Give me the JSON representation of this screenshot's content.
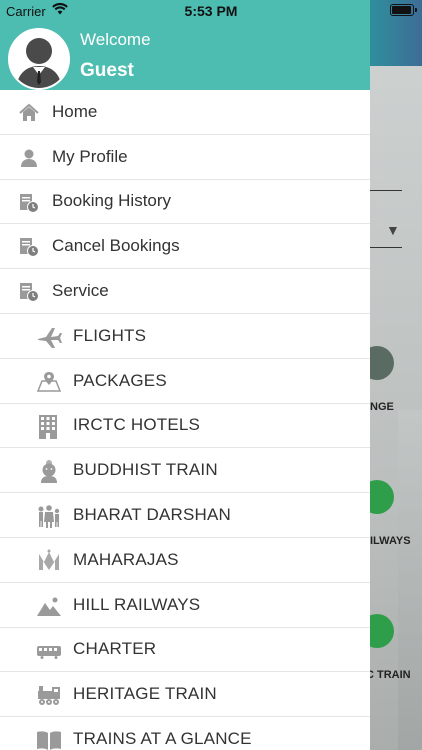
{
  "status_bar": {
    "carrier": "Carrier",
    "time": "5:53 PM"
  },
  "drawer": {
    "header_color": "#4dbdb1",
    "welcome": "Welcome",
    "user_name": "Guest",
    "menu_items": [
      {
        "label": "Home",
        "icon": "home-icon"
      },
      {
        "label": "My Profile",
        "icon": "profile-icon"
      },
      {
        "label": "Booking History",
        "icon": "booking-history-icon"
      },
      {
        "label": "Cancel Bookings",
        "icon": "cancel-bookings-icon"
      },
      {
        "label": "Service",
        "icon": "service-icon"
      }
    ],
    "service_items": [
      {
        "label": "FLIGHTS",
        "icon": "airplane-icon"
      },
      {
        "label": "PACKAGES",
        "icon": "map-pin-icon"
      },
      {
        "label": "IRCTC HOTELS",
        "icon": "hotel-building-icon"
      },
      {
        "label": "BUDDHIST TRAIN",
        "icon": "buddha-icon"
      },
      {
        "label": "BHARAT DARSHAN",
        "icon": "people-group-icon"
      },
      {
        "label": "MAHARAJAS",
        "icon": "maharajas-logo-icon"
      },
      {
        "label": "HILL RAILWAYS",
        "icon": "mountain-icon"
      },
      {
        "label": "CHARTER",
        "icon": "train-coach-icon"
      },
      {
        "label": "HERITAGE TRAIN",
        "icon": "steam-engine-icon"
      },
      {
        "label": "TRAINS AT A GLANCE",
        "icon": "book-icon"
      }
    ]
  },
  "background_app": {
    "labels": [
      "NGE",
      "ILWAYS",
      "C TRAIN"
    ]
  }
}
